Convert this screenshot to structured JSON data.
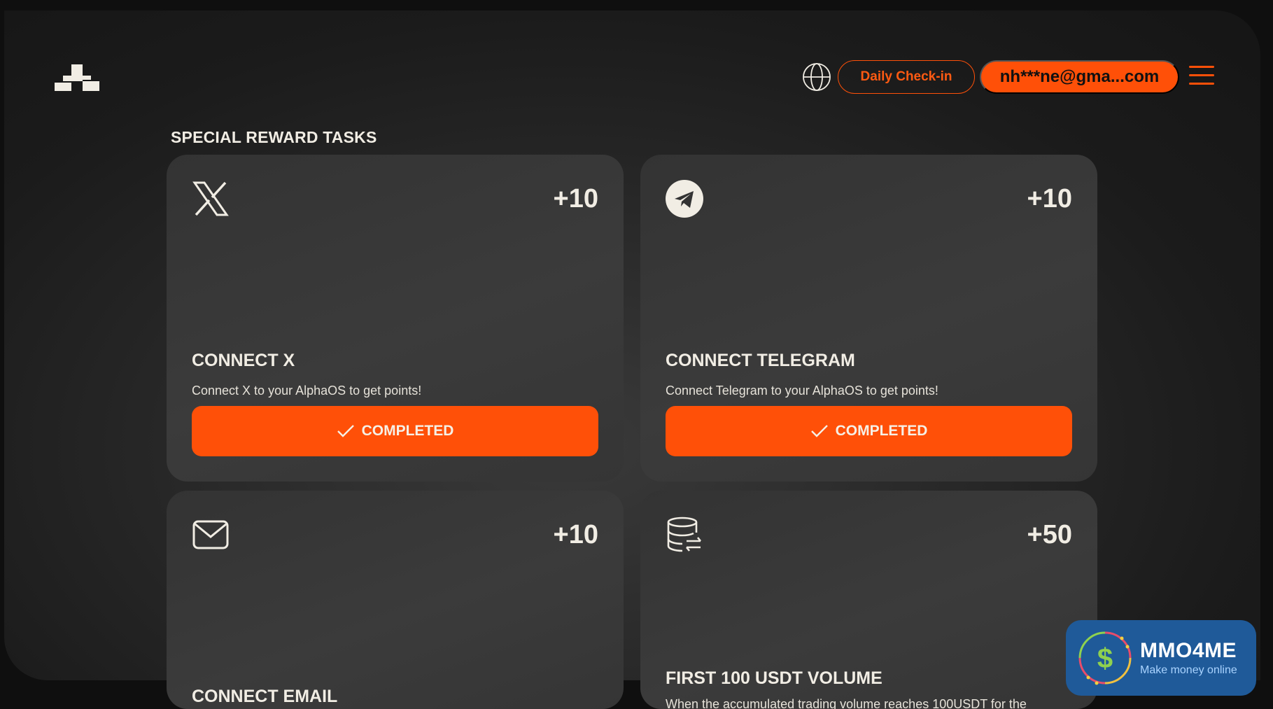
{
  "header": {
    "logo_icon": "alphaos-logo-icon",
    "language_icon": "globe-icon",
    "checkin_label": "Daily Check-in",
    "account_label": "nh***ne@gma...com",
    "menu_icon": "hamburger-menu-icon"
  },
  "section": {
    "title": "SPECIAL REWARD TASKS"
  },
  "tasks": [
    {
      "icon": "x-logo-icon",
      "points": "+10",
      "title": "CONNECT X",
      "description": "Connect X to your AlphaOS to get points!",
      "button_label": "COMPLETED"
    },
    {
      "icon": "telegram-icon",
      "points": "+10",
      "title": "CONNECT TELEGRAM",
      "description": "Connect Telegram to your AlphaOS to get points!",
      "button_label": "COMPLETED"
    },
    {
      "icon": "mail-icon",
      "points": "+10",
      "title": "CONNECT EMAIL"
    },
    {
      "icon": "database-exchange-icon",
      "points": "+50",
      "title": "FIRST 100 USDT VOLUME",
      "description": "When the accumulated trading volume reaches 100USDT for the"
    }
  ],
  "watermark": {
    "brand": "MMO4ME",
    "tagline": "Make money online"
  },
  "colors": {
    "accent": "#ff5008",
    "text": "#f1ede4",
    "card": "#363636",
    "background": "#0f0f0f",
    "badge": "#1f5a99"
  }
}
